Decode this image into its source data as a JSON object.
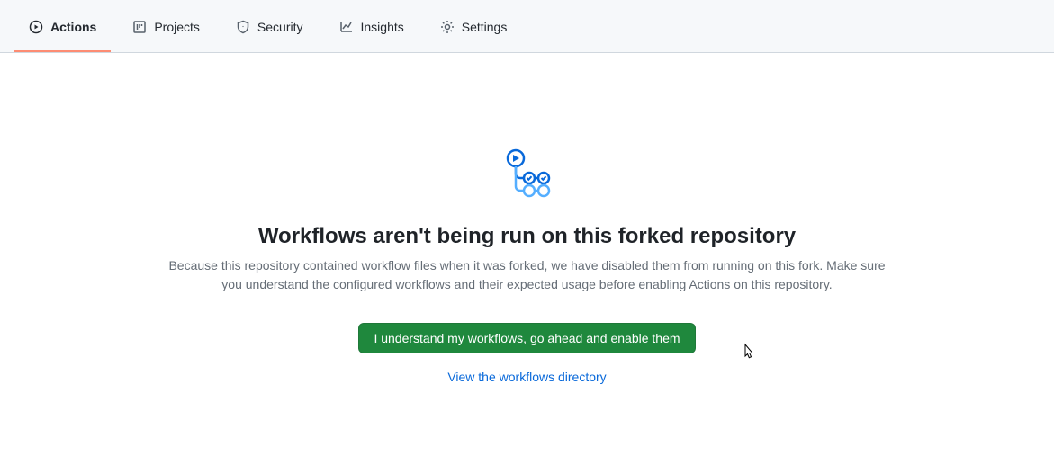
{
  "nav": {
    "tabs": [
      {
        "label": "Actions",
        "icon": "play-circle-icon",
        "active": true
      },
      {
        "label": "Projects",
        "icon": "project-icon",
        "active": false
      },
      {
        "label": "Security",
        "icon": "shield-icon",
        "active": false
      },
      {
        "label": "Insights",
        "icon": "graph-icon",
        "active": false
      },
      {
        "label": "Settings",
        "icon": "gear-icon",
        "active": false
      }
    ]
  },
  "main": {
    "title": "Workflows aren't being run on this forked repository",
    "description": "Because this repository contained workflow files when it was forked, we have disabled them from running on this fork. Make sure you understand the configured workflows and their expected usage before enabling Actions on this repository.",
    "enable_button": "I understand my workflows, go ahead and enable them",
    "view_link": "View the workflows directory"
  },
  "colors": {
    "accent_blue": "#0969da",
    "button_green": "#1f883d",
    "active_underline": "#fd8c73"
  }
}
